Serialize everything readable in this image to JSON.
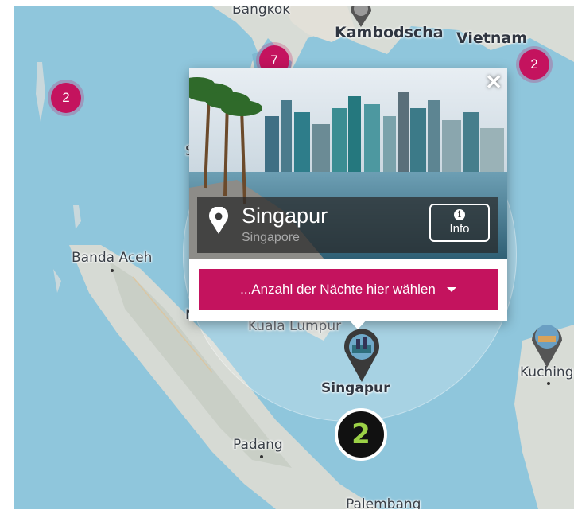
{
  "map": {
    "countries": {
      "cambodia": "Kambodscha",
      "vietnam": "Vietnam"
    },
    "cities": {
      "bangkok": "Bangkok",
      "banda_aceh": "Banda Aceh",
      "kuala_lumpur": "Kuala Lumpur",
      "singapore": "Singapur",
      "padang": "Padang",
      "palembang": "Palembang",
      "kuching": "Kuching",
      "sumatra_partial": "Su",
      "medan_partial": "M"
    },
    "clusters": [
      {
        "id": "west",
        "count": "2"
      },
      {
        "id": "thailand",
        "count": "7"
      },
      {
        "id": "vietnam",
        "count": "2"
      }
    ]
  },
  "popup": {
    "title": "Singapur",
    "subtitle": "Singapore",
    "info_label": "Info",
    "nights_placeholder": "...Anzahl der Nächte hier wählen",
    "close_icon": "close-icon",
    "accent_color": "#c4135e"
  },
  "step": {
    "number": "2",
    "color": "#9bd146"
  }
}
